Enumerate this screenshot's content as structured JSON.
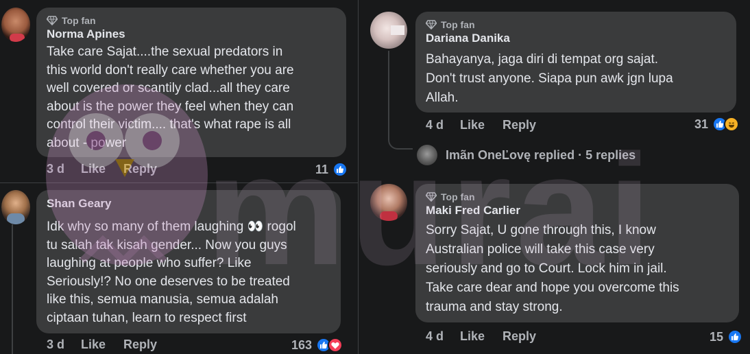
{
  "badge_label": "Top fan",
  "comments": [
    {
      "author": "Norma Apines",
      "text": "Take care Sajat....the sexual predators in\nthis world don't really care whether you are\nwell covered or scantily clad...all they care\nabout is the power they feel when they can\ncontrol their victim.... that's what rape is all\nabout - power",
      "time": "3 d",
      "like": "Like",
      "reply": "Reply",
      "reaction_count": "11",
      "reactions": [
        "like"
      ],
      "top_fan": true
    },
    {
      "author": "Shan Geary",
      "text": "Idk why so many of them laughing 👀 rogol\ntu salah tak kisah gender... Now you guys\nlaughing at people who suffer? Like\nSeriously!? No one deserves to be treated\nlike this, semua manusia, semua adalah\nciptaan tuhan, learn to respect first",
      "time": "3 d",
      "like": "Like",
      "reply": "Reply",
      "reaction_count": "163",
      "reactions": [
        "like",
        "love"
      ],
      "top_fan": false
    },
    {
      "author": "Dariana Danika",
      "text": "Bahayanya, jaga diri di tempat org sajat.\nDon't trust anyone. Siapa pun awk jgn lupa\nAllah.",
      "time": "4 d",
      "like": "Like",
      "reply": "Reply",
      "reaction_count": "31",
      "reactions": [
        "like",
        "haha"
      ],
      "top_fan": true,
      "replies": {
        "name": "Imãn OneĽovę",
        "label": "replied",
        "count": "· 5 replies"
      }
    },
    {
      "author": "Maki Fred Carlier",
      "text": "Sorry Sajat, U gone through this, I know\nAustralian police will take this case very\nseriously and go to Court. Lock him in jail.\nTake care dear and hope you overcome this\ntrauma and stay strong.",
      "time": "4 d",
      "like": "Like",
      "reply": "Reply",
      "reaction_count": "15",
      "reactions": [
        "like"
      ],
      "top_fan": true
    }
  ],
  "watermark": "murai",
  "colors": {
    "background": "#18191a",
    "bubble": "#3a3b3c",
    "like_blue": "#1877f2",
    "love_red": "#f33e58",
    "haha_yellow": "#f7b125",
    "watermark_pink": "#d88fd0"
  }
}
